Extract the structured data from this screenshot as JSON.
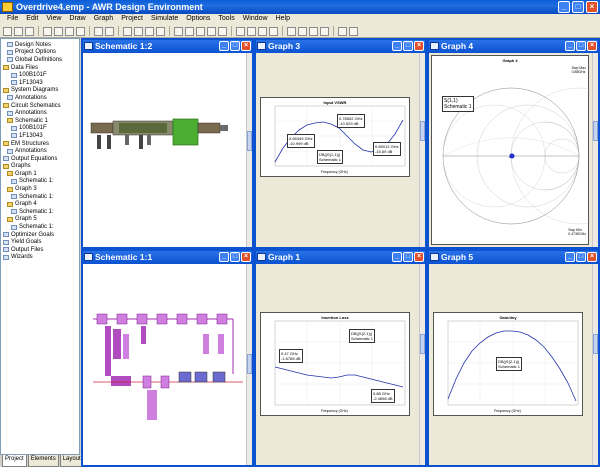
{
  "app": {
    "title": "Overdrive4.emp - AWR Design Environment"
  },
  "menu": [
    "File",
    "Edit",
    "View",
    "Draw",
    "Graph",
    "Project",
    "Simulate",
    "Options",
    "Tools",
    "Window",
    "Help"
  ],
  "tree": {
    "items": [
      {
        "label": "Design Notes",
        "type": "leaf"
      },
      {
        "label": "Project Options",
        "type": "leaf"
      },
      {
        "label": "Global Definitions",
        "type": "leaf"
      },
      {
        "label": "Data Files",
        "type": "folder"
      },
      {
        "label": "100B101F",
        "type": "leaf"
      },
      {
        "label": "1F13043",
        "type": "leaf"
      },
      {
        "label": "System Diagrams",
        "type": "folder"
      },
      {
        "label": "Annotations",
        "type": "leaf"
      },
      {
        "label": "Circuit Schematics",
        "type": "folder"
      },
      {
        "label": "Annotations",
        "type": "leaf"
      },
      {
        "label": "Schematic 1",
        "type": "folder"
      },
      {
        "label": "100B101F",
        "type": "leaf"
      },
      {
        "label": "1F13043",
        "type": "leaf"
      },
      {
        "label": "EM Structures",
        "type": "folder"
      },
      {
        "label": "Annotations",
        "type": "leaf"
      },
      {
        "label": "Output Equations",
        "type": "leaf"
      },
      {
        "label": "Graphs",
        "type": "folder"
      },
      {
        "label": "Graph 1",
        "type": "folder"
      },
      {
        "label": "Schematic 1:",
        "type": "leaf"
      },
      {
        "label": "Graph 3",
        "type": "folder"
      },
      {
        "label": "Schematic 1:",
        "type": "leaf"
      },
      {
        "label": "Graph 4",
        "type": "folder"
      },
      {
        "label": "Schematic 1:",
        "type": "leaf"
      },
      {
        "label": "Graph 5",
        "type": "folder"
      },
      {
        "label": "Schematic 1:",
        "type": "leaf"
      },
      {
        "label": "Optimizer Goals",
        "type": "leaf"
      },
      {
        "label": "Yield Goals",
        "type": "leaf"
      },
      {
        "label": "Output Files",
        "type": "leaf"
      },
      {
        "label": "Wizards",
        "type": "leaf"
      }
    ]
  },
  "tabs": [
    "Project",
    "Elements",
    "Layout"
  ],
  "windows": {
    "schematic12": {
      "title": "Schematic 1:2"
    },
    "graph3": {
      "title": "Graph 3",
      "inner_title": "Input VSWR",
      "markers": [
        "0.78502 GHz\n-10.529 dB",
        "0.65349 GHz\n-10.999 dB",
        "0.89012 GHz\n-15.69 dB"
      ],
      "legend": "DB(|S(1,1)|)\nSchematic 1",
      "xlabel": "Frequency (GHz)"
    },
    "graph4": {
      "title": "Graph 4",
      "inner_title": "Graph 4",
      "legend_l1": "S(1,1)",
      "legend_l2": "Schematic 1",
      "swp_max": "Swp Max\n0.88GHz",
      "swp_min": "Swp Min\n0.4735GHz"
    },
    "schematic11": {
      "title": "Schematic 1:1"
    },
    "graph1": {
      "title": "Graph 1",
      "inner_title": "Insertion Loss",
      "marker1": "0.47 GHz\n-1.6785 dB",
      "marker2": "0.88 GHz\n-2.4698 dB",
      "legend": "DB(|S(2,1)|)\nSchematic 1",
      "xlabel": "Frequency (GHz)"
    },
    "graph5": {
      "title": "Graph 5",
      "inner_title": "Gain/dny",
      "legend": "DB(|S(2,1)|)\nSchematic 1",
      "xlabel": "Frequency (GHz)"
    }
  }
}
